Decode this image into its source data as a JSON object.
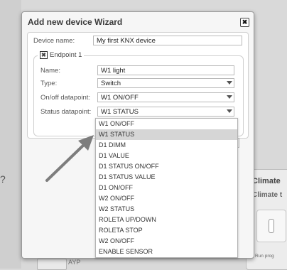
{
  "background": {
    "left_fragment": "?",
    "climate": {
      "title": "Climate",
      "subtitle": "Climate t",
      "button": "Run prog"
    },
    "bottom_text": "AYP"
  },
  "wizard": {
    "title": "Add new device Wizard",
    "device_name_label": "Device name:",
    "device_name_value": "My first KNX device",
    "endpoint_label": "Endpoint 1",
    "name_label": "Name:",
    "name_value": "W1 light",
    "type_label": "Type:",
    "type_value": "Switch",
    "onoff_label": "On/off datapoint:",
    "onoff_value": "W1 ON/OFF",
    "status_label": "Status datapoint:",
    "status_value": "W1 STATUS"
  },
  "dropdown": {
    "selected_index": 1,
    "options": [
      "W1 ON/OFF",
      "W1 STATUS",
      "D1 DIMM",
      "D1 VALUE",
      "D1 STATUS ON/OFF",
      "D1 STATUS VALUE",
      "D1 ON/OFF",
      "W2 ON/OFF",
      "W2 STATUS",
      "ROLETA UP/DOWN",
      "ROLETA STOP",
      "W2 ON/OFF",
      "ENABLE SENSOR"
    ]
  },
  "colors": {
    "dialog_bg": "#f6f6f6",
    "selected_option_bg": "#d6d6d6",
    "arrow": "#7d7d7d"
  }
}
